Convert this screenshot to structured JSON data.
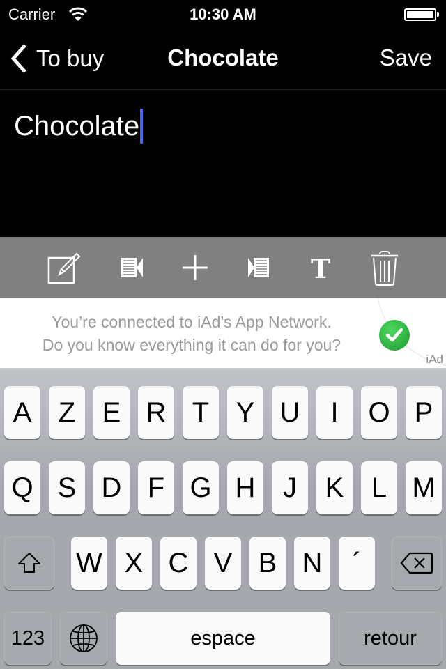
{
  "status_bar": {
    "carrier": "Carrier",
    "time": "10:30 AM",
    "battery_level": 1.0
  },
  "nav": {
    "back_label": "To buy",
    "title": "Chocolate",
    "save_label": "Save"
  },
  "editor": {
    "text": "Chocolate"
  },
  "toolbar": {
    "items": [
      {
        "icon": "edit-icon"
      },
      {
        "icon": "collapse-left-icon"
      },
      {
        "icon": "add-icon"
      },
      {
        "icon": "expand-right-icon"
      },
      {
        "icon": "text-format-icon"
      },
      {
        "icon": "trash-icon"
      }
    ]
  },
  "ad": {
    "line1": "You’re connected to iAd’s App Network.",
    "line2": "Do you know everything it can do for you?",
    "label": "iAd",
    "check_color": "#2fb844"
  },
  "keyboard": {
    "row1": [
      "A",
      "Z",
      "E",
      "R",
      "T",
      "Y",
      "U",
      "I",
      "O",
      "P"
    ],
    "row2": [
      "Q",
      "S",
      "D",
      "F",
      "G",
      "H",
      "J",
      "K",
      "L",
      "M"
    ],
    "row3": [
      "W",
      "X",
      "C",
      "V",
      "B",
      "N",
      "´"
    ],
    "numbers_label": "123",
    "space_label": "espace",
    "return_label": "retour"
  },
  "colors": {
    "caret": "#4a6ae6",
    "toolbar_bg": "#808080"
  }
}
